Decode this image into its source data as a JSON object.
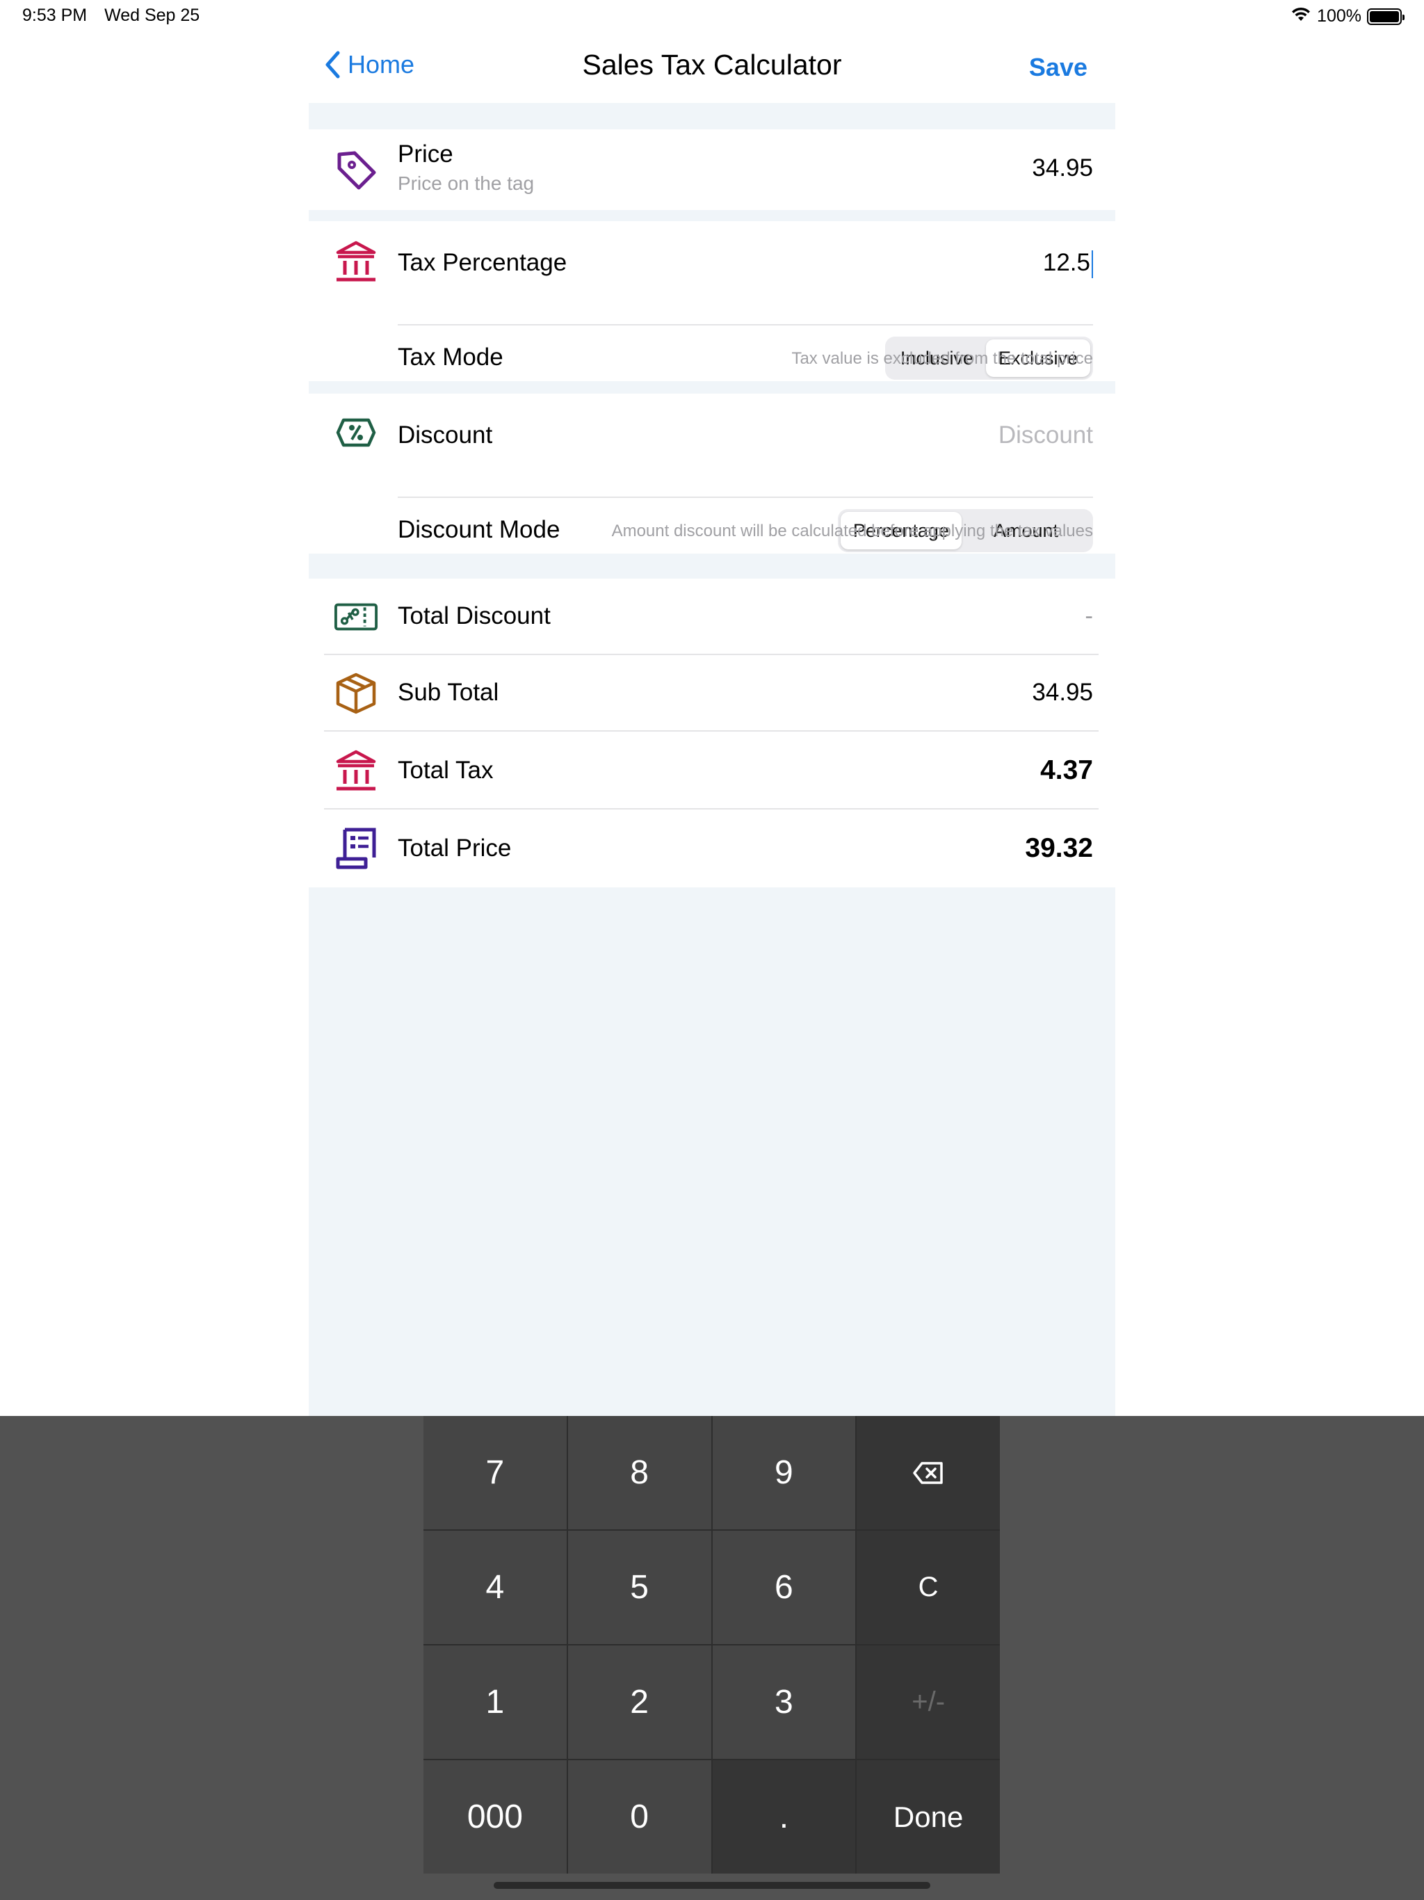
{
  "status_bar": {
    "time": "9:53 PM",
    "date": "Wed Sep 25",
    "battery": "100%",
    "battery_level": 1.0
  },
  "nav": {
    "back_label": "Home",
    "title": "Sales Tax Calculator",
    "save_label": "Save"
  },
  "price": {
    "label": "Price",
    "sublabel": "Price on the tag",
    "value": "34.95"
  },
  "tax": {
    "percentage_label": "Tax Percentage",
    "percentage_value": "12.5",
    "mode_label": "Tax Mode",
    "mode_options": [
      "Inclusive",
      "Exclusive"
    ],
    "mode_selected": "Exclusive",
    "hint": "Tax value is excluded from the total price"
  },
  "discount": {
    "label": "Discount",
    "placeholder": "Discount",
    "mode_label": "Discount Mode",
    "mode_options": [
      "Percentage",
      "Amount"
    ],
    "mode_selected": "Percentage",
    "hint": "Amount discount will be calculated before applying the tax values"
  },
  "results": {
    "total_discount_label": "Total Discount",
    "total_discount_value": "-",
    "sub_total_label": "Sub Total",
    "sub_total_value": "34.95",
    "total_tax_label": "Total Tax",
    "total_tax_value": "4.37",
    "total_price_label": "Total Price",
    "total_price_value": "39.32"
  },
  "icon_colors": {
    "price": "#6b1f8f",
    "tax": "#c8174d",
    "discount": "#1f5f45",
    "sub_total": "#a86114",
    "total_price": "#3e1f95"
  },
  "keypad": {
    "keys": [
      "7",
      "8",
      "9",
      "backspace",
      "4",
      "5",
      "6",
      "C",
      "1",
      "2",
      "3",
      "+/-",
      "000",
      "0",
      ".",
      "Done"
    ]
  }
}
